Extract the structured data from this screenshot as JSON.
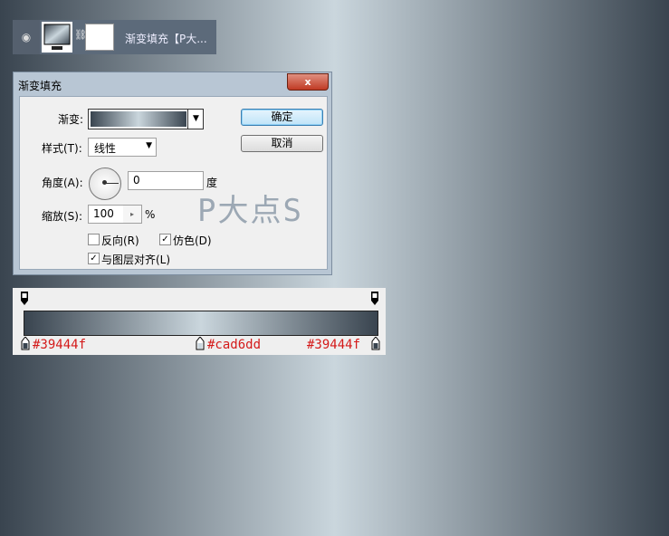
{
  "colors": {
    "stop_dark": "#39444f",
    "stop_light": "#cad6dd"
  },
  "layer": {
    "name": "渐变填充【P大..."
  },
  "dialog": {
    "title": "渐变填充",
    "close_label": "x",
    "gradient_label": "渐变:",
    "style_label": "样式(T):",
    "style_value": "线性",
    "angle_label": "角度(A):",
    "angle_value": "0",
    "angle_unit": "度",
    "scale_label": "缩放(S):",
    "scale_value": "100",
    "scale_unit": "%",
    "reverse_label": "反向(R)",
    "reverse_checked": false,
    "dither_label": "仿色(D)",
    "dither_checked": true,
    "align_label": "与图层对齐(L)",
    "align_checked": true,
    "ok_label": "确定",
    "cancel_label": "取消"
  },
  "watermark": "P大点S",
  "gradient_editor": {
    "stops": [
      "#39444f",
      "#cad6dd",
      "#39444f"
    ]
  }
}
